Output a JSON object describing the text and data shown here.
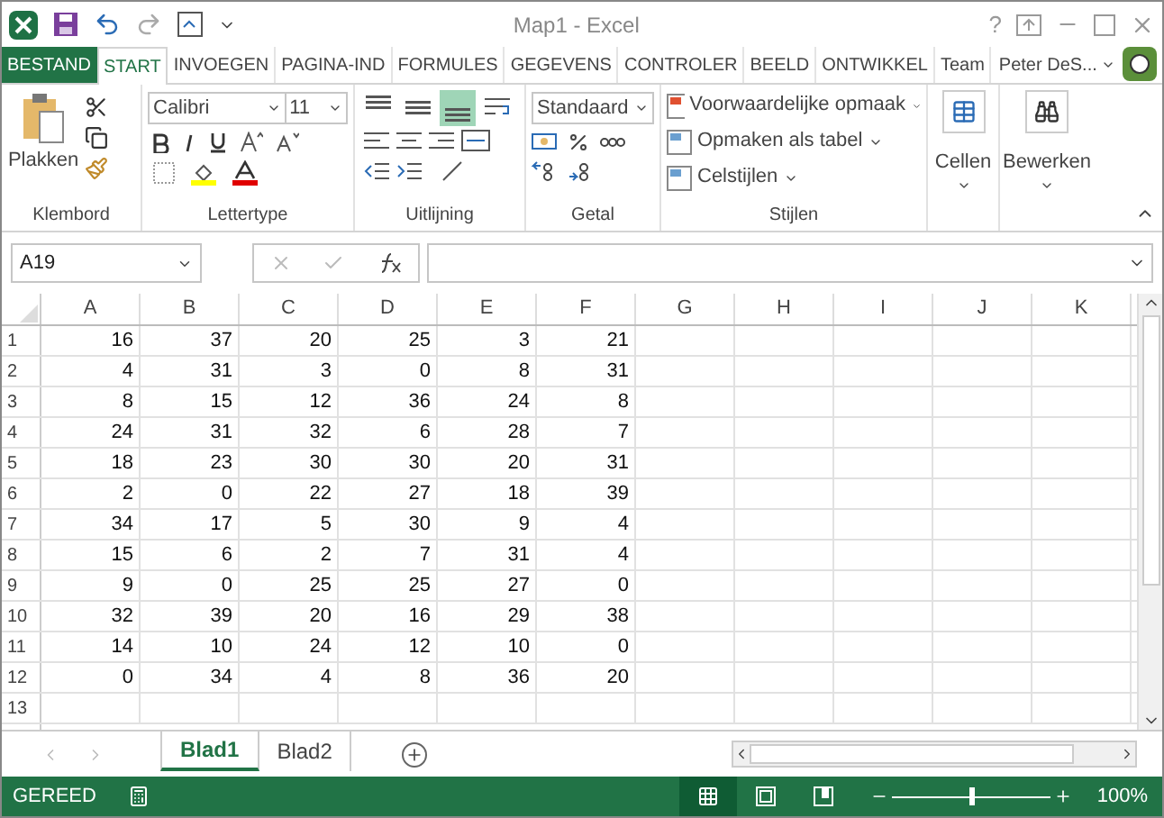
{
  "window": {
    "title": "Map1 - Excel",
    "help": "?",
    "user": "Peter DeS..."
  },
  "tabs": [
    {
      "label": "BESTAND",
      "kind": "file",
      "selected": false
    },
    {
      "label": "START",
      "kind": "tab",
      "selected": true
    },
    {
      "label": "INVOEGEN",
      "kind": "tab",
      "selected": false
    },
    {
      "label": "PAGINA-IND",
      "kind": "tab",
      "selected": false
    },
    {
      "label": "FORMULES",
      "kind": "tab",
      "selected": false
    },
    {
      "label": "GEGEVENS",
      "kind": "tab",
      "selected": false
    },
    {
      "label": "CONTROLER",
      "kind": "tab",
      "selected": false
    },
    {
      "label": "BEELD",
      "kind": "tab",
      "selected": false
    },
    {
      "label": "ONTWIKKEL",
      "kind": "tab",
      "selected": false
    },
    {
      "label": "Team",
      "kind": "tab",
      "selected": false
    }
  ],
  "ribbon": {
    "clipboard": {
      "paste": "Plakken",
      "group": "Klembord"
    },
    "font": {
      "name": "Calibri",
      "size": "11",
      "group": "Lettertype"
    },
    "alignment": {
      "group": "Uitlijning",
      "vertical": [
        {
          "kind": "top",
          "selected": false
        },
        {
          "kind": "middle",
          "selected": false
        },
        {
          "kind": "bottom",
          "selected": true
        }
      ]
    },
    "number": {
      "format": "Standaard",
      "group": "Getal"
    },
    "styles": {
      "items": [
        "Voorwaardelijke opmaak",
        "Opmaken als tabel",
        "Celstijlen"
      ],
      "group": "Stijlen"
    },
    "cells": "Cellen",
    "editing": "Bewerken"
  },
  "formula_bar": {
    "name_box": "A19"
  },
  "sheet": {
    "columns": [
      "A",
      "B",
      "C",
      "D",
      "E",
      "F",
      "G",
      "H",
      "I",
      "J",
      "K"
    ],
    "rows": [
      {
        "header": "1",
        "cells": [
          "16",
          "37",
          "20",
          "25",
          "3",
          "21"
        ]
      },
      {
        "header": "2",
        "cells": [
          "4",
          "31",
          "3",
          "0",
          "8",
          "31"
        ]
      },
      {
        "header": "3",
        "cells": [
          "8",
          "15",
          "12",
          "36",
          "24",
          "8"
        ]
      },
      {
        "header": "4",
        "cells": [
          "24",
          "31",
          "32",
          "6",
          "28",
          "7"
        ]
      },
      {
        "header": "5",
        "cells": [
          "18",
          "23",
          "30",
          "30",
          "20",
          "31"
        ]
      },
      {
        "header": "6",
        "cells": [
          "2",
          "0",
          "22",
          "27",
          "18",
          "39"
        ]
      },
      {
        "header": "7",
        "cells": [
          "34",
          "17",
          "5",
          "30",
          "9",
          "4"
        ]
      },
      {
        "header": "8",
        "cells": [
          "15",
          "6",
          "2",
          "7",
          "31",
          "4"
        ]
      },
      {
        "header": "9",
        "cells": [
          "9",
          "0",
          "25",
          "25",
          "27",
          "0"
        ]
      },
      {
        "header": "10",
        "cells": [
          "32",
          "39",
          "20",
          "16",
          "29",
          "38"
        ]
      },
      {
        "header": "11",
        "cells": [
          "14",
          "10",
          "24",
          "12",
          "10",
          "0"
        ]
      },
      {
        "header": "12",
        "cells": [
          "0",
          "34",
          "4",
          "8",
          "36",
          "20"
        ]
      },
      {
        "header": "13"
      }
    ]
  },
  "sheet_tabs": [
    {
      "label": "Blad1",
      "selected": true
    },
    {
      "label": "Blad2",
      "selected": false
    }
  ],
  "status_bar": {
    "status": "GEREED",
    "views": [
      {
        "kind": "normal",
        "selected": true
      },
      {
        "kind": "layout",
        "selected": false
      },
      {
        "kind": "break",
        "selected": false
      }
    ],
    "zoom": {
      "level": 0.5,
      "reading": "100%"
    }
  }
}
